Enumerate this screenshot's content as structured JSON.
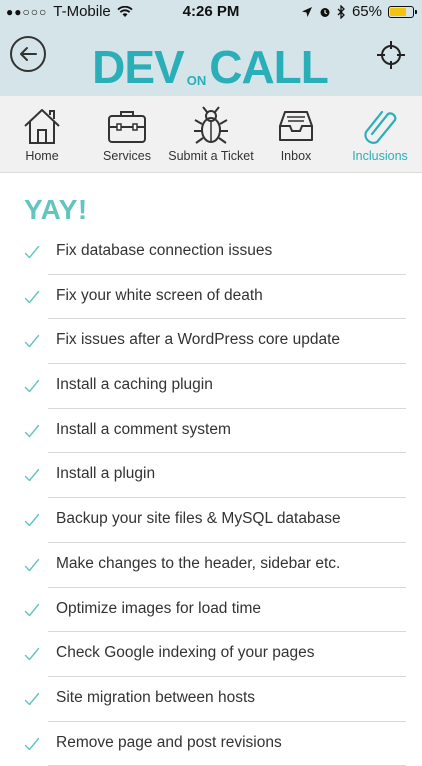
{
  "status": {
    "carrier": "T-Mobile",
    "signal_dots": "●●○○○",
    "time": "4:26 PM",
    "battery": "65%"
  },
  "header": {
    "logo_main_left": "DEV",
    "logo_small": "ON",
    "logo_main_right": "CALL"
  },
  "tabs": [
    {
      "label": "Home",
      "icon": "home-icon"
    },
    {
      "label": "Services",
      "icon": "briefcase-icon"
    },
    {
      "label": "Submit a Ticket",
      "icon": "bug-icon"
    },
    {
      "label": "Inbox",
      "icon": "inbox-icon"
    },
    {
      "label": "Inclusions",
      "icon": "paperclip-icon",
      "active": true
    }
  ],
  "content": {
    "heading": "YAY!",
    "items": [
      "Fix database connection issues",
      "Fix your white screen of death",
      "Fix issues after a WordPress core update",
      "Install a caching plugin",
      "Install a comment system",
      "Install a plugin",
      "Backup your site files & MySQL database",
      "Make changes to the header, sidebar etc.",
      "Optimize images for load time",
      "Check Google indexing of your pages",
      "Site migration between hosts",
      "Remove page and post revisions"
    ]
  },
  "colors": {
    "accent": "#2aaeb8",
    "check": "#63c5bf",
    "header_bg": "#d5e4e8",
    "battery_fill": "#f2c40f"
  }
}
